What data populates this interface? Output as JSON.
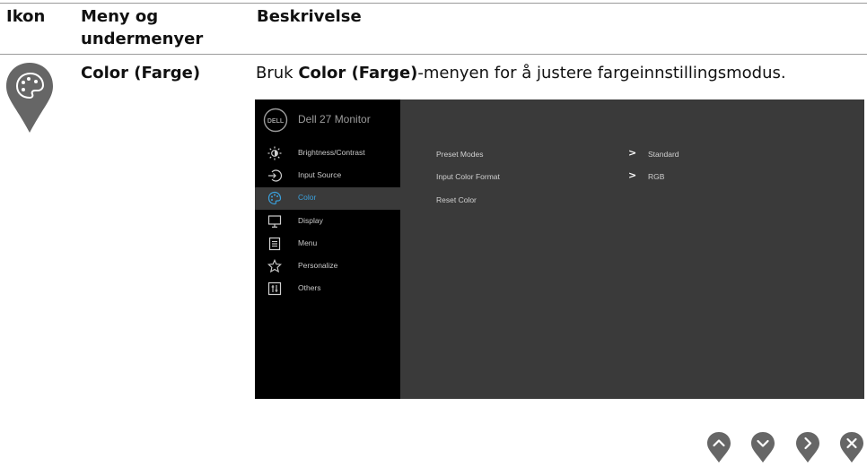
{
  "table": {
    "headers": {
      "ikon": "Ikon",
      "meny": "Meny og undermenyer",
      "beskrivelse": "Beskrivelse"
    },
    "row": {
      "icon": "color-palette-icon",
      "name": "Color (Farge)",
      "desc_prefix": "Bruk ",
      "desc_bold": "Color (Farge)",
      "desc_suffix": "-menyen for å justere fargeinnstillingsmodus."
    }
  },
  "osd": {
    "logo": "DELL",
    "title": "Dell 27 Monitor",
    "accent_color": "#3aa0dc",
    "menu": [
      {
        "label": "Brightness/Contrast",
        "icon": "brightness-icon"
      },
      {
        "label": "Input Source",
        "icon": "input-source-icon"
      },
      {
        "label": "Color",
        "icon": "color-palette-icon",
        "active": true
      },
      {
        "label": "Display",
        "icon": "display-icon"
      },
      {
        "label": "Menu",
        "icon": "menu-icon"
      },
      {
        "label": "Personalize",
        "icon": "star-icon"
      },
      {
        "label": "Others",
        "icon": "others-icon"
      }
    ],
    "options": [
      {
        "label": "Preset Modes",
        "chevron": ">",
        "value": "Standard"
      },
      {
        "label": "Input Color Format",
        "chevron": ">",
        "value": "RGB"
      },
      {
        "label": "Reset Color",
        "chevron": "",
        "value": ""
      }
    ]
  },
  "nav_buttons": [
    "up-icon",
    "down-icon",
    "right-icon",
    "close-icon"
  ]
}
